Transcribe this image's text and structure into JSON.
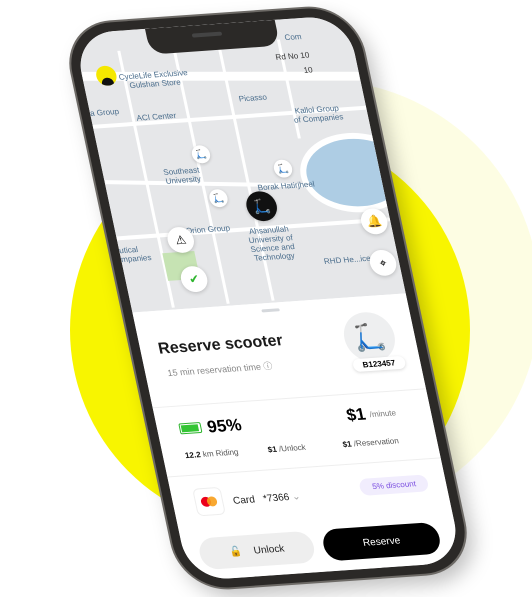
{
  "map": {
    "labels": [
      "Com",
      "Rd No 10",
      "10",
      "CycleLife Exclusive\nGulshan Store",
      "a Group",
      "ACI Center",
      "Picasso",
      "Kallol Group\nof Companies",
      "Southeast\nUniversity",
      "Borak Hatirjheel",
      "Orion Group",
      "Ahsanullah\nUniversity of\nScience and\nTechnology",
      "RHD He...ice",
      "utical\nmpanies"
    ]
  },
  "sheet": {
    "title": "Reserve scooter",
    "subtitle": "15 min reservation time",
    "scooter_id": "B123457",
    "battery": "95%",
    "battery_level": 0.95,
    "price": "$1",
    "price_unit": "/minute",
    "range_value": "12.2",
    "range_unit": "km Riding",
    "unlock_price": "$1",
    "unlock_unit": "/Unlock",
    "reservation_price": "$1",
    "reservation_unit": "/Reservation",
    "card_label": "Card",
    "card_number": "*7366",
    "discount": "5% discount",
    "unlock_button": "Unlock",
    "reserve_button": "Reserve"
  },
  "colors": {
    "accent": "#f8f500",
    "battery": "#34c534",
    "discount": "#7a4de0"
  }
}
